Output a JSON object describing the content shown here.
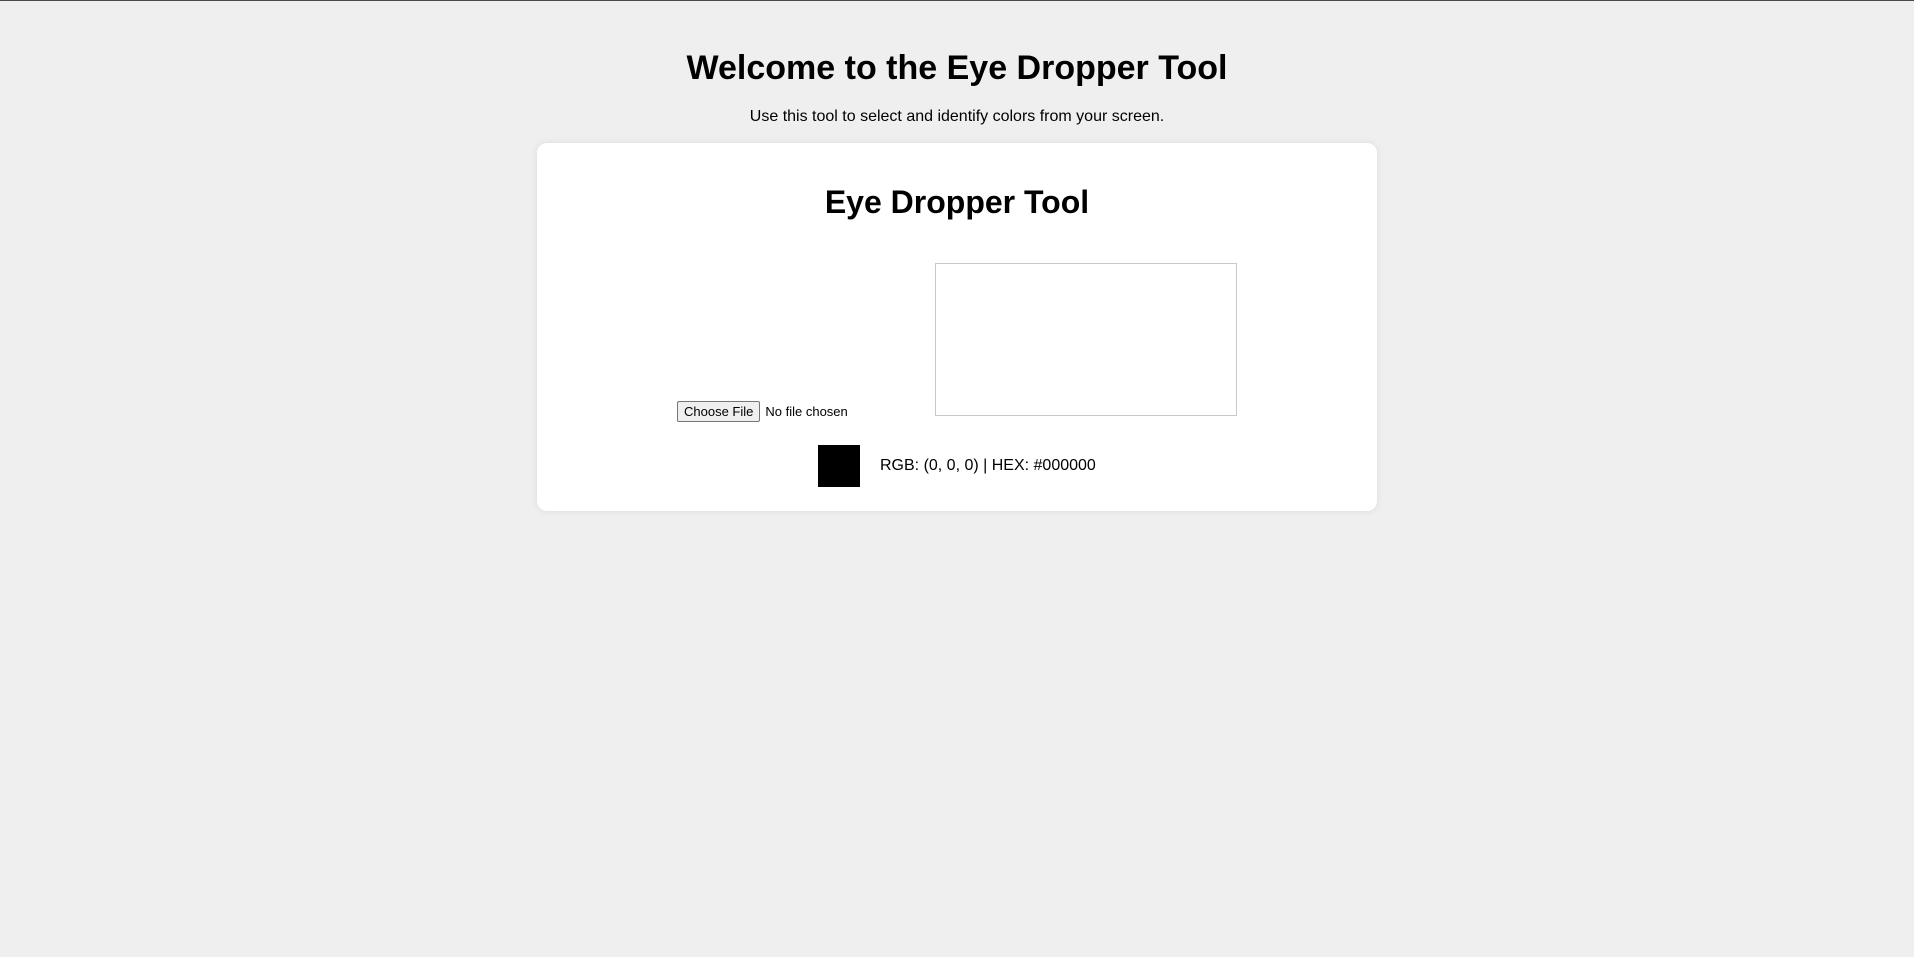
{
  "header": {
    "title": "Welcome to the Eye Dropper Tool",
    "subtitle": "Use this tool to select and identify colors from your screen."
  },
  "card": {
    "title": "Eye Dropper Tool",
    "file_input": {
      "button_label": "Choose File",
      "status": "No file chosen"
    },
    "picked_color": {
      "swatch_color": "#000000",
      "readout": "RGB: (0, 0, 0) | HEX: #000000"
    }
  },
  "colors": {
    "background": "#efefef",
    "card": "#ffffff"
  }
}
